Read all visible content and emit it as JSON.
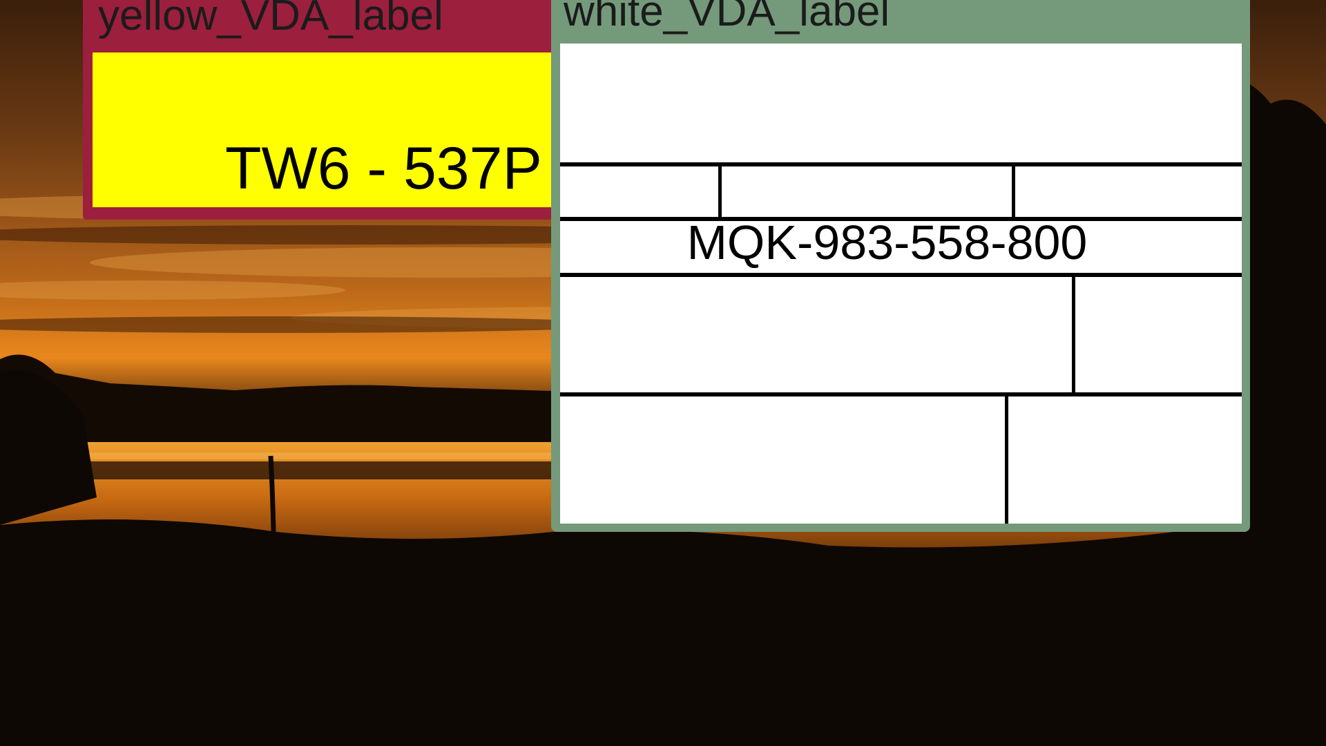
{
  "desktop": {
    "wallpaper": "sunset-lake-landscape",
    "colors": {
      "sky_top": "#6b3a14",
      "sky_glow": "#e8871c",
      "water": "#c96a12",
      "silhouette": "#0d0804"
    }
  },
  "windows": {
    "yellow": {
      "title": "yellow_VDA_label",
      "plate_text": "TW6 - 537P",
      "frame_color": "#9c1f3d",
      "content_color": "#ffff00"
    },
    "white": {
      "title": "white_VDA_label",
      "code_text": "MQK-983-558-800",
      "frame_color": "#749a7b",
      "content_color": "#ffffff"
    }
  }
}
